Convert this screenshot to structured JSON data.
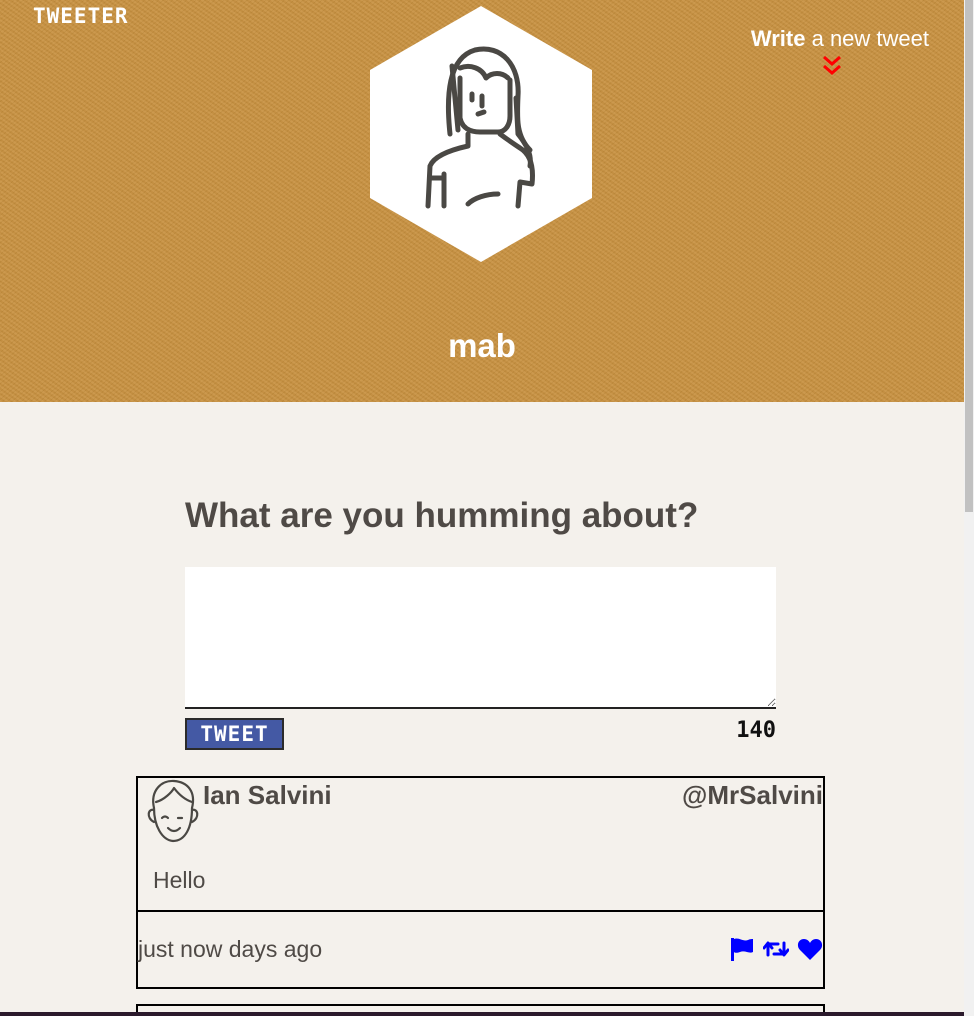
{
  "app": {
    "brand": "TWEETER"
  },
  "header": {
    "compose_strong": "Write",
    "compose_rest": "a new tweet",
    "username": "mab",
    "chevron_color": "#ff0000",
    "background_color": "#c8913f"
  },
  "compose": {
    "title": "What are you humming about?",
    "textarea_value": "",
    "button_label": "TWEET",
    "counter": "140",
    "button_color": "#4459a4"
  },
  "tweets": [
    {
      "name": "Ian Salvini",
      "handle": "@MrSalvini",
      "body": "Hello",
      "time": "just now days ago",
      "actions": [
        "flag-icon",
        "retweet-icon",
        "heart-icon"
      ],
      "action_color": "#0000ff"
    }
  ]
}
